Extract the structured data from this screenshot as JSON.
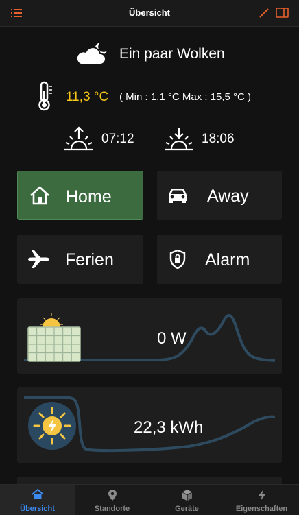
{
  "header": {
    "title": "Übersicht",
    "left_icon": "list-icon",
    "right_icons": [
      "edit-icon",
      "sidebar-icon"
    ],
    "accent": "#e8612c"
  },
  "weather": {
    "condition": "Ein paar Wolken",
    "icon": "cloud-moon-icon",
    "temperature": "11,3 °C",
    "minmax": "( Min : 1,1 °C  Max : 15,5 °C )",
    "sunrise": "07:12",
    "sunset": "18:06",
    "temp_color": "#f5c518"
  },
  "modes": [
    {
      "label": "Home",
      "icon": "home-icon",
      "active": true
    },
    {
      "label": "Away",
      "icon": "car-icon",
      "active": false
    },
    {
      "label": "Ferien",
      "icon": "airplane-icon",
      "active": false
    },
    {
      "label": "Alarm",
      "icon": "shield-lock-icon",
      "active": false
    }
  ],
  "cards": [
    {
      "value": "0 W",
      "icon": "solar-panel-icon"
    },
    {
      "value": "22,3 kWh",
      "icon": "sun-energy-icon"
    }
  ],
  "tabs": [
    {
      "label": "Übersicht",
      "icon": "home-icon",
      "active": true
    },
    {
      "label": "Standorte",
      "icon": "map-pin-icon",
      "active": false
    },
    {
      "label": "Geräte",
      "icon": "cube-icon",
      "active": false
    },
    {
      "label": "Eigenschaften",
      "icon": "bolt-icon",
      "active": false
    }
  ],
  "colors": {
    "active_mode": "#3b6b3f",
    "active_tab": "#3d8bf0",
    "chart_line": "#2d4a5e"
  }
}
